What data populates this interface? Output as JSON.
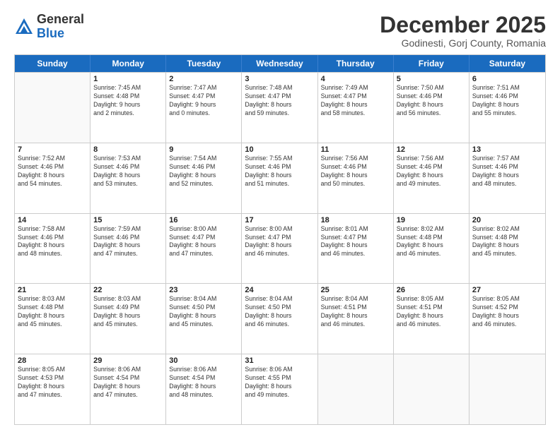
{
  "logo": {
    "general": "General",
    "blue": "Blue"
  },
  "title": "December 2025",
  "location": "Godinesti, Gorj County, Romania",
  "days_of_week": [
    "Sunday",
    "Monday",
    "Tuesday",
    "Wednesday",
    "Thursday",
    "Friday",
    "Saturday"
  ],
  "weeks": [
    [
      {
        "day": "",
        "info": ""
      },
      {
        "day": "1",
        "info": "Sunrise: 7:45 AM\nSunset: 4:48 PM\nDaylight: 9 hours\nand 2 minutes."
      },
      {
        "day": "2",
        "info": "Sunrise: 7:47 AM\nSunset: 4:47 PM\nDaylight: 9 hours\nand 0 minutes."
      },
      {
        "day": "3",
        "info": "Sunrise: 7:48 AM\nSunset: 4:47 PM\nDaylight: 8 hours\nand 59 minutes."
      },
      {
        "day": "4",
        "info": "Sunrise: 7:49 AM\nSunset: 4:47 PM\nDaylight: 8 hours\nand 58 minutes."
      },
      {
        "day": "5",
        "info": "Sunrise: 7:50 AM\nSunset: 4:46 PM\nDaylight: 8 hours\nand 56 minutes."
      },
      {
        "day": "6",
        "info": "Sunrise: 7:51 AM\nSunset: 4:46 PM\nDaylight: 8 hours\nand 55 minutes."
      }
    ],
    [
      {
        "day": "7",
        "info": "Sunrise: 7:52 AM\nSunset: 4:46 PM\nDaylight: 8 hours\nand 54 minutes."
      },
      {
        "day": "8",
        "info": "Sunrise: 7:53 AM\nSunset: 4:46 PM\nDaylight: 8 hours\nand 53 minutes."
      },
      {
        "day": "9",
        "info": "Sunrise: 7:54 AM\nSunset: 4:46 PM\nDaylight: 8 hours\nand 52 minutes."
      },
      {
        "day": "10",
        "info": "Sunrise: 7:55 AM\nSunset: 4:46 PM\nDaylight: 8 hours\nand 51 minutes."
      },
      {
        "day": "11",
        "info": "Sunrise: 7:56 AM\nSunset: 4:46 PM\nDaylight: 8 hours\nand 50 minutes."
      },
      {
        "day": "12",
        "info": "Sunrise: 7:56 AM\nSunset: 4:46 PM\nDaylight: 8 hours\nand 49 minutes."
      },
      {
        "day": "13",
        "info": "Sunrise: 7:57 AM\nSunset: 4:46 PM\nDaylight: 8 hours\nand 48 minutes."
      }
    ],
    [
      {
        "day": "14",
        "info": "Sunrise: 7:58 AM\nSunset: 4:46 PM\nDaylight: 8 hours\nand 48 minutes."
      },
      {
        "day": "15",
        "info": "Sunrise: 7:59 AM\nSunset: 4:46 PM\nDaylight: 8 hours\nand 47 minutes."
      },
      {
        "day": "16",
        "info": "Sunrise: 8:00 AM\nSunset: 4:47 PM\nDaylight: 8 hours\nand 47 minutes."
      },
      {
        "day": "17",
        "info": "Sunrise: 8:00 AM\nSunset: 4:47 PM\nDaylight: 8 hours\nand 46 minutes."
      },
      {
        "day": "18",
        "info": "Sunrise: 8:01 AM\nSunset: 4:47 PM\nDaylight: 8 hours\nand 46 minutes."
      },
      {
        "day": "19",
        "info": "Sunrise: 8:02 AM\nSunset: 4:48 PM\nDaylight: 8 hours\nand 46 minutes."
      },
      {
        "day": "20",
        "info": "Sunrise: 8:02 AM\nSunset: 4:48 PM\nDaylight: 8 hours\nand 45 minutes."
      }
    ],
    [
      {
        "day": "21",
        "info": "Sunrise: 8:03 AM\nSunset: 4:48 PM\nDaylight: 8 hours\nand 45 minutes."
      },
      {
        "day": "22",
        "info": "Sunrise: 8:03 AM\nSunset: 4:49 PM\nDaylight: 8 hours\nand 45 minutes."
      },
      {
        "day": "23",
        "info": "Sunrise: 8:04 AM\nSunset: 4:50 PM\nDaylight: 8 hours\nand 45 minutes."
      },
      {
        "day": "24",
        "info": "Sunrise: 8:04 AM\nSunset: 4:50 PM\nDaylight: 8 hours\nand 46 minutes."
      },
      {
        "day": "25",
        "info": "Sunrise: 8:04 AM\nSunset: 4:51 PM\nDaylight: 8 hours\nand 46 minutes."
      },
      {
        "day": "26",
        "info": "Sunrise: 8:05 AM\nSunset: 4:51 PM\nDaylight: 8 hours\nand 46 minutes."
      },
      {
        "day": "27",
        "info": "Sunrise: 8:05 AM\nSunset: 4:52 PM\nDaylight: 8 hours\nand 46 minutes."
      }
    ],
    [
      {
        "day": "28",
        "info": "Sunrise: 8:05 AM\nSunset: 4:53 PM\nDaylight: 8 hours\nand 47 minutes."
      },
      {
        "day": "29",
        "info": "Sunrise: 8:06 AM\nSunset: 4:54 PM\nDaylight: 8 hours\nand 47 minutes."
      },
      {
        "day": "30",
        "info": "Sunrise: 8:06 AM\nSunset: 4:54 PM\nDaylight: 8 hours\nand 48 minutes."
      },
      {
        "day": "31",
        "info": "Sunrise: 8:06 AM\nSunset: 4:55 PM\nDaylight: 8 hours\nand 49 minutes."
      },
      {
        "day": "",
        "info": ""
      },
      {
        "day": "",
        "info": ""
      },
      {
        "day": "",
        "info": ""
      }
    ]
  ]
}
